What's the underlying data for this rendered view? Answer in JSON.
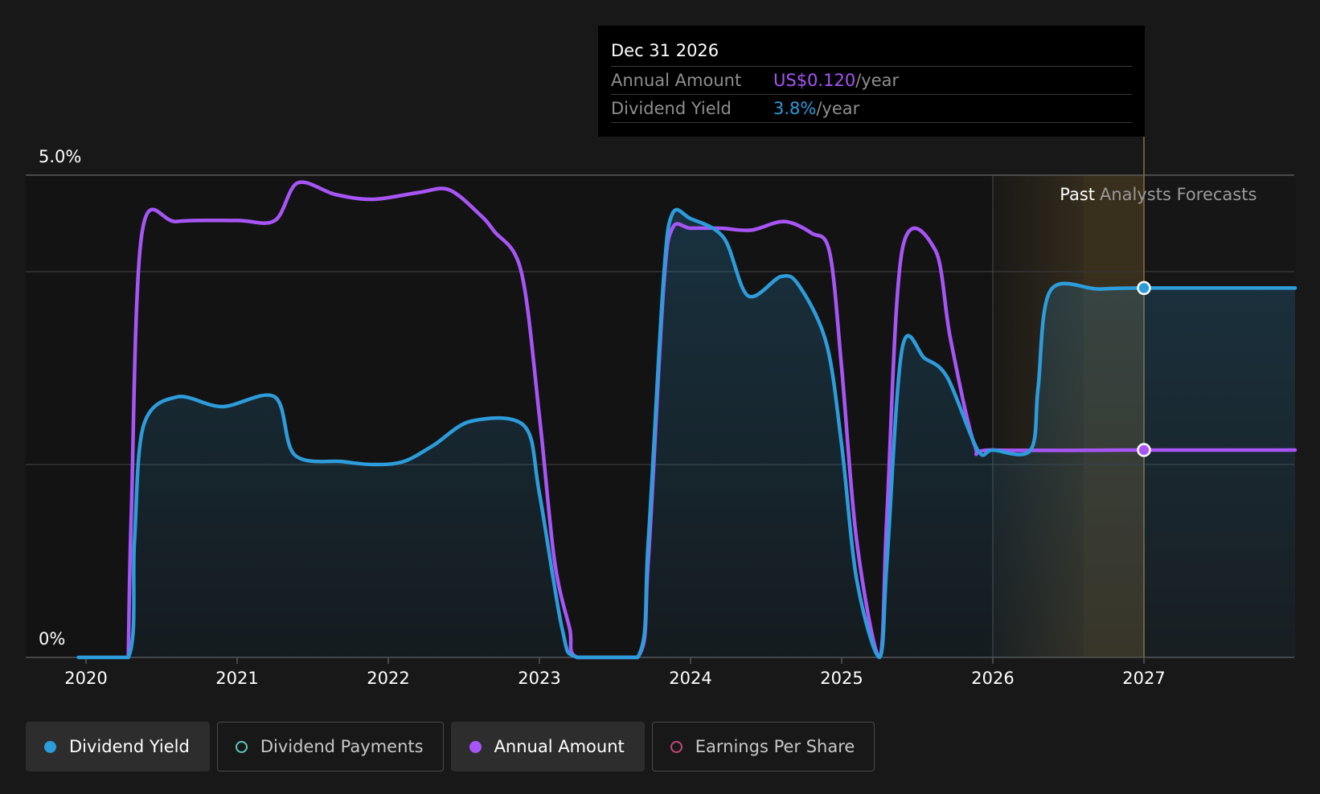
{
  "tooltip": {
    "date": "Dec 31 2026",
    "rows": [
      {
        "label": "Annual Amount",
        "value": "US$0.120",
        "suffix": "/year",
        "color": "#a855f7"
      },
      {
        "label": "Dividend Yield",
        "value": "3.8%",
        "suffix": "/year",
        "color": "#2d9cdb"
      }
    ]
  },
  "regions": {
    "past": "Past",
    "forecast": "Analysts Forecasts"
  },
  "legend": [
    {
      "label": "Dividend Yield",
      "color": "#2d9cdb",
      "style": "filled",
      "active": true
    },
    {
      "label": "Dividend Payments",
      "color": "#5fc9b8",
      "style": "hollow",
      "active": false
    },
    {
      "label": "Annual Amount",
      "color": "#a855f7",
      "style": "filled",
      "active": true
    },
    {
      "label": "Earnings Per Share",
      "color": "#c2497a",
      "style": "hollow",
      "active": false
    }
  ],
  "chart_data": {
    "type": "line",
    "y_axis": {
      "ticks": [
        "5.0%",
        "0%"
      ],
      "range": [
        0,
        5.0
      ],
      "unit": "%"
    },
    "x_axis": {
      "ticks": [
        "2020",
        "2021",
        "2022",
        "2023",
        "2024",
        "2025",
        "2026",
        "2027"
      ],
      "range": [
        2019.6,
        2028.0
      ]
    },
    "grid": true,
    "legend_position": "bottom",
    "past_forecast_split": 2026.0,
    "forecast_highlight": [
      2026.6,
      2027.0
    ],
    "series": [
      {
        "name": "Dividend Yield",
        "color": "#2d9cdb",
        "unit": "%",
        "filled": true,
        "points": [
          [
            2019.95,
            0
          ],
          [
            2020.28,
            0
          ],
          [
            2020.32,
            1.2
          ],
          [
            2020.38,
            2.4
          ],
          [
            2020.6,
            2.7
          ],
          [
            2020.9,
            2.6
          ],
          [
            2021.25,
            2.7
          ],
          [
            2021.38,
            2.1
          ],
          [
            2021.7,
            2.03
          ],
          [
            2021.9,
            2.0
          ],
          [
            2022.1,
            2.03
          ],
          [
            2022.3,
            2.2
          ],
          [
            2022.55,
            2.45
          ],
          [
            2022.9,
            2.4
          ],
          [
            2023.0,
            1.7
          ],
          [
            2023.15,
            0.3
          ],
          [
            2023.25,
            0
          ],
          [
            2023.65,
            0
          ],
          [
            2023.72,
            1.2
          ],
          [
            2023.82,
            3.9
          ],
          [
            2023.88,
            4.6
          ],
          [
            2024.0,
            4.55
          ],
          [
            2024.22,
            4.35
          ],
          [
            2024.38,
            3.75
          ],
          [
            2024.6,
            3.95
          ],
          [
            2024.72,
            3.85
          ],
          [
            2024.9,
            3.25
          ],
          [
            2025.0,
            2.2
          ],
          [
            2025.1,
            0.8
          ],
          [
            2025.25,
            0
          ],
          [
            2025.3,
            1.0
          ],
          [
            2025.4,
            3.2
          ],
          [
            2025.55,
            3.1
          ],
          [
            2025.7,
            2.9
          ],
          [
            2025.9,
            2.15
          ],
          [
            2026.0,
            2.15
          ],
          [
            2026.25,
            2.15
          ],
          [
            2026.3,
            2.8
          ],
          [
            2026.38,
            3.8
          ],
          [
            2026.7,
            3.82
          ],
          [
            2027.0,
            3.83
          ],
          [
            2028.0,
            3.83
          ]
        ]
      },
      {
        "name": "Annual Amount",
        "color": "#a855f7",
        "unit": "%",
        "filled": false,
        "points": [
          [
            2020.28,
            0
          ],
          [
            2020.3,
            1.5
          ],
          [
            2020.37,
            4.4
          ],
          [
            2020.6,
            4.52
          ],
          [
            2021.0,
            4.53
          ],
          [
            2021.25,
            4.53
          ],
          [
            2021.4,
            4.92
          ],
          [
            2021.65,
            4.8
          ],
          [
            2021.9,
            4.75
          ],
          [
            2022.2,
            4.82
          ],
          [
            2022.4,
            4.85
          ],
          [
            2022.6,
            4.6
          ],
          [
            2022.7,
            4.42
          ],
          [
            2022.88,
            4.0
          ],
          [
            2023.0,
            2.5
          ],
          [
            2023.1,
            1.0
          ],
          [
            2023.2,
            0.3
          ],
          [
            2023.25,
            0
          ],
          [
            2023.65,
            0
          ],
          [
            2023.72,
            1.0
          ],
          [
            2023.82,
            3.8
          ],
          [
            2023.88,
            4.45
          ],
          [
            2024.0,
            4.45
          ],
          [
            2024.2,
            4.45
          ],
          [
            2024.4,
            4.43
          ],
          [
            2024.62,
            4.52
          ],
          [
            2024.8,
            4.4
          ],
          [
            2024.92,
            4.2
          ],
          [
            2025.0,
            3.0
          ],
          [
            2025.1,
            1.2
          ],
          [
            2025.25,
            0
          ],
          [
            2025.3,
            1.5
          ],
          [
            2025.4,
            4.22
          ],
          [
            2025.62,
            4.22
          ],
          [
            2025.72,
            3.3
          ],
          [
            2025.88,
            2.2
          ],
          [
            2026.0,
            2.15
          ],
          [
            2027.0,
            2.15
          ],
          [
            2028.0,
            2.15
          ]
        ]
      }
    ],
    "markers": [
      {
        "series": "Dividend Yield",
        "x": 2027.0,
        "y": 3.83
      },
      {
        "series": "Annual Amount",
        "x": 2027.0,
        "y": 2.15
      }
    ]
  }
}
